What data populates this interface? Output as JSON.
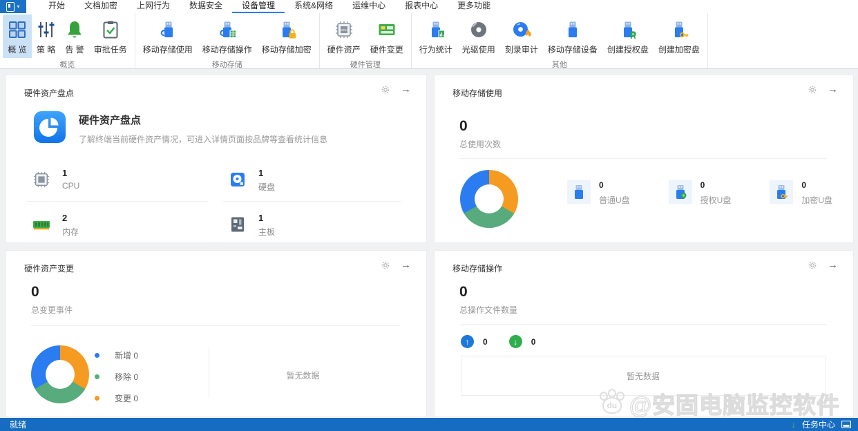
{
  "colors": {
    "accent": "#2b7cf0",
    "statusbar_blue": "#166cc1",
    "donut_orange": "#f59b22",
    "donut_green": "#57ab7d",
    "donut_blue": "#2b7cf0",
    "selected_ribbon_bg": "#cbe2f6"
  },
  "icons": {
    "arrow_right": "→",
    "up": "↑",
    "down": "↓",
    "caret": "▾",
    "cpu_text": "CPU"
  },
  "menu": {
    "tabs": [
      "开始",
      "文档加密",
      "上网行为",
      "数据安全",
      "设备管理",
      "系统&网络",
      "运维中心",
      "报表中心",
      "更多功能"
    ],
    "active_tab": "设备管理"
  },
  "ribbon": {
    "groups": [
      {
        "label": "概览",
        "items": [
          {
            "label": "概 览",
            "icon": "overview-grid-icon",
            "active": true
          },
          {
            "label": "策 略",
            "icon": "policy-sliders-icon"
          },
          {
            "label": "告 警",
            "icon": "alert-bell-icon"
          },
          {
            "label": "审批任务",
            "icon": "approval-clipboard-icon"
          }
        ]
      },
      {
        "label": "移动存储",
        "items": [
          {
            "label": "移动存储使用",
            "icon": "usb-usage-icon"
          },
          {
            "label": "移动存储操作",
            "icon": "usb-operation-icon"
          },
          {
            "label": "移动存储加密",
            "icon": "usb-lock-icon"
          }
        ]
      },
      {
        "label": "硬件管理",
        "items": [
          {
            "label": "硬件资产",
            "icon": "cpu-chip-icon"
          },
          {
            "label": "硬件变更",
            "icon": "hardware-board-icon"
          }
        ]
      },
      {
        "label": "其他",
        "items": [
          {
            "label": "行为统计",
            "icon": "usb-stats-icon"
          },
          {
            "label": "光驱使用",
            "icon": "disc-icon"
          },
          {
            "label": "刻录审计",
            "icon": "disc-burn-icon"
          },
          {
            "label": "移动存储设备",
            "icon": "usb-device-icon"
          },
          {
            "label": "创建授权盘",
            "icon": "usb-medal-icon"
          },
          {
            "label": "创建加密盘",
            "icon": "usb-key-icon"
          }
        ]
      }
    ]
  },
  "cards": {
    "hardware_inventory": {
      "header": "硬件资产盘点",
      "title": "硬件资产盘点",
      "description": "了解终端当前硬件资产情况，可进入详情页面按品牌等查看统计信息",
      "stats": [
        {
          "value": "1",
          "label": "CPU",
          "icon": "cpu-small-icon"
        },
        {
          "value": "1",
          "label": "硬盘",
          "icon": "disk-icon"
        },
        {
          "value": "2",
          "label": "内存",
          "icon": "ram-icon"
        },
        {
          "value": "1",
          "label": "主板",
          "icon": "motherboard-icon"
        }
      ]
    },
    "storage_usage": {
      "header": "移动存储使用",
      "total": "0",
      "total_label": "总使用次数",
      "items": [
        {
          "value": "0",
          "label": "普通U盘",
          "icon": "usb-plain-mini-icon"
        },
        {
          "value": "0",
          "label": "授权U盘",
          "icon": "usb-medal-mini-icon"
        },
        {
          "value": "0",
          "label": "加密U盘",
          "icon": "usb-key-mini-icon"
        }
      ]
    },
    "hardware_change": {
      "header": "硬件资产变更",
      "total": "0",
      "total_label": "总变更事件",
      "legend": [
        {
          "label": "新增 0",
          "dot_style": "background:#2b7cf0"
        },
        {
          "label": "移除 0",
          "dot_style": "background:#57ab7d"
        },
        {
          "label": "变更 0",
          "dot_style": "background:#f59b22"
        }
      ],
      "empty": "暂无数据"
    },
    "storage_ops": {
      "header": "移动存储操作",
      "total": "0",
      "total_label": "总操作文件数量",
      "upload_count": "0",
      "download_count": "0",
      "empty": "暂无数据"
    }
  },
  "statusbar": {
    "ready": "就绪",
    "task_center": "任务中心"
  },
  "watermark": {
    "paw_label": "du",
    "text": "@安固电脑监控软件"
  },
  "chart_data": [
    {
      "type": "pie",
      "title": "移动存储使用",
      "categories": [
        "普通U盘",
        "授权U盘",
        "加密U盘"
      ],
      "values": [
        0,
        0,
        0
      ],
      "total": 0,
      "total_label": "总使用次数",
      "donut": true,
      "legend_position": "right-items",
      "segments": [
        {
          "color": "#f59b22",
          "pct": 33.4
        },
        {
          "color": "#57ab7d",
          "pct": 33.3
        },
        {
          "color": "#2b7cf0",
          "pct": 33.3
        }
      ]
    },
    {
      "type": "pie",
      "title": "硬件资产变更",
      "categories": [
        "新增",
        "移除",
        "变更"
      ],
      "values": [
        0,
        0,
        0
      ],
      "total": 0,
      "total_label": "总变更事件",
      "donut": true,
      "legend_position": "right",
      "segments": [
        {
          "color": "#f59b22",
          "pct": 33.4
        },
        {
          "color": "#57ab7d",
          "pct": 33.3
        },
        {
          "color": "#2b7cf0",
          "pct": 33.3
        }
      ]
    }
  ]
}
